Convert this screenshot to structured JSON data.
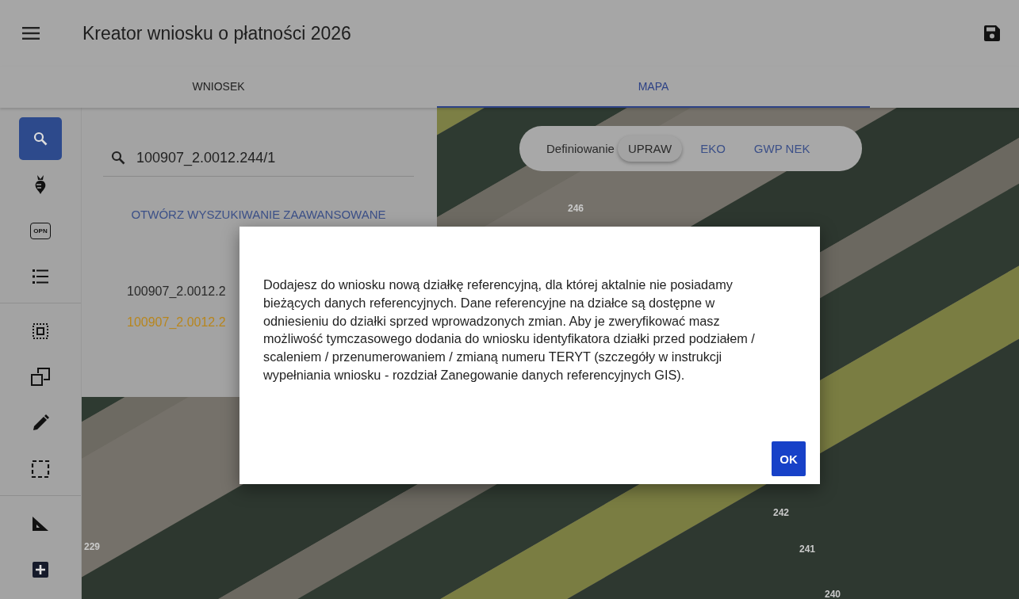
{
  "app_bar": {
    "title": "Kreator wniosku o płatności 2026"
  },
  "tabs": [
    {
      "label": "WNIOSEK",
      "selected": false
    },
    {
      "label": "MAPA",
      "selected": true
    }
  ],
  "toolbar": [
    {
      "kind": "search",
      "selected": true
    },
    {
      "kind": "beet",
      "selected": false
    },
    {
      "kind": "badge",
      "label": "OPN",
      "selected": false
    },
    {
      "kind": "list",
      "selected": false
    },
    {
      "kind": "select-area",
      "selected": false
    },
    {
      "kind": "copy",
      "selected": false
    },
    {
      "kind": "pencil",
      "selected": false
    },
    {
      "kind": "frame",
      "selected": false
    },
    {
      "kind": "measure",
      "selected": false
    },
    {
      "kind": "add",
      "selected": false
    }
  ],
  "search_panel": {
    "value": "100907_2.0012.244/1",
    "link": "OTWÓRZ WYSZUKIWANIE ZAAWANSOWANE",
    "results": [
      {
        "text": "100907_2.0012.2",
        "highlighted": false
      },
      {
        "text": "100907_2.0012.2",
        "highlighted": true
      }
    ]
  },
  "mode_switch": {
    "label": "Definiowanie",
    "options": [
      {
        "label": "UPRAW",
        "selected": true
      },
      {
        "label": "EKO",
        "selected": false
      },
      {
        "label": "GWP NEK",
        "selected": false
      }
    ]
  },
  "map_labels": [
    "246",
    "229",
    "242",
    "241",
    "240"
  ],
  "dialog": {
    "message": "Dodajesz do wniosku nową działkę referencyjną, dla której aktalnie nie posiadamy bieżących danych referencyjnych. Dane referencyjne na działce są dostępne w odniesieniu do działki sprzed wprowadzonych zmian. Aby je zweryfikować masz możliwość tymczasowego dodania do wniosku identyfikatora działki przed podziałem / scaleniem / przenumerowaniem / zmianą numeru TERYT (szczegóły w instrukcji wypełniania wniosku - rozdział Zanegowanie danych referencyjnych GIS).",
    "button": "OK"
  }
}
